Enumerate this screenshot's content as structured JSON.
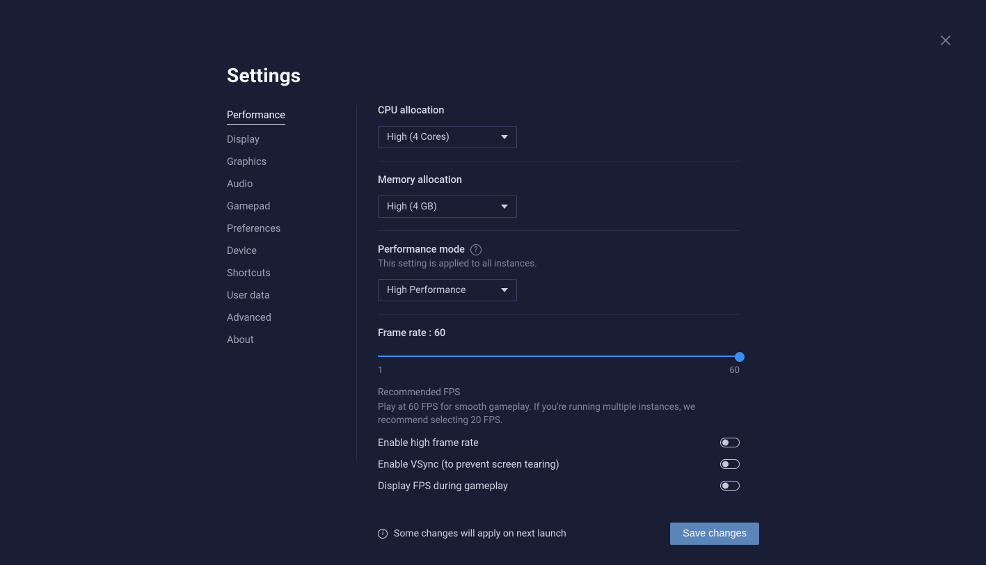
{
  "header": {
    "title": "Settings"
  },
  "sidebar": {
    "items": [
      "Performance",
      "Display",
      "Graphics",
      "Audio",
      "Gamepad",
      "Preferences",
      "Device",
      "Shortcuts",
      "User data",
      "Advanced",
      "About"
    ],
    "active_index": 0
  },
  "cpu": {
    "label": "CPU allocation",
    "value": "High (4 Cores)"
  },
  "memory": {
    "label": "Memory allocation",
    "value": "High (4 GB)"
  },
  "perfmode": {
    "label": "Performance mode",
    "hint": "This setting is applied to all instances.",
    "value": "High Performance"
  },
  "framerate": {
    "label_prefix": "Frame rate : ",
    "value": "60",
    "min": "1",
    "max": "60",
    "rec_label": "Recommended FPS",
    "rec_hint": "Play at 60 FPS for smooth gameplay. If you're running multiple instances, we recommend selecting 20 FPS."
  },
  "toggles": {
    "high_frame": "Enable high frame rate",
    "vsync": "Enable VSync (to prevent screen tearing)",
    "show_fps": "Display FPS during gameplay"
  },
  "footer": {
    "info": "Some changes will apply on next launch",
    "save": "Save changes"
  }
}
